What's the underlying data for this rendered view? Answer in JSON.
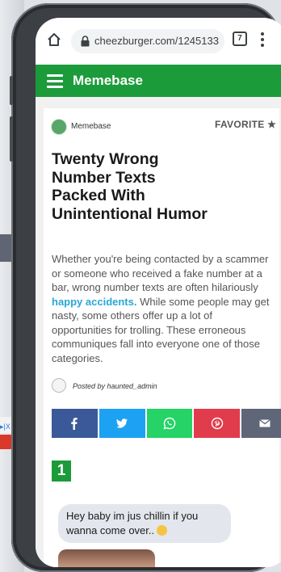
{
  "browser": {
    "url": "cheezburger.com/1245133",
    "tab_count": "7"
  },
  "site": {
    "name": "Memebase"
  },
  "article": {
    "publisher": "Memebase",
    "favorite_label": "FAVORITE ★",
    "title": "Twenty Wrong Number Texts Packed With Unintentional Humor",
    "body_before_link": "Whether you're being contacted by a scammer or someone who received a fake number at a bar, wrong number texts are often hilariously ",
    "body_link": "happy accidents.",
    "body_after_link": " While some people may get nasty, some others offer up a lot of opportunities for trolling. These erroneous communiques fall into everyone one of those categories.",
    "author": "Posted by haunted_admin"
  },
  "share": [
    {
      "name": "facebook",
      "color": "#3b5998"
    },
    {
      "name": "twitter",
      "color": "#1da1f2"
    },
    {
      "name": "whatsapp",
      "color": "#25d366"
    },
    {
      "name": "pinterest",
      "color": "#e03c4b"
    },
    {
      "name": "email",
      "color": "#5e6678"
    }
  ],
  "list_item": {
    "number": "1",
    "message": "Hey baby im jus chillin if you wanna come over.."
  },
  "colors": {
    "brand_green": "#1c9b3a",
    "link_blue": "#2aa6d8"
  }
}
